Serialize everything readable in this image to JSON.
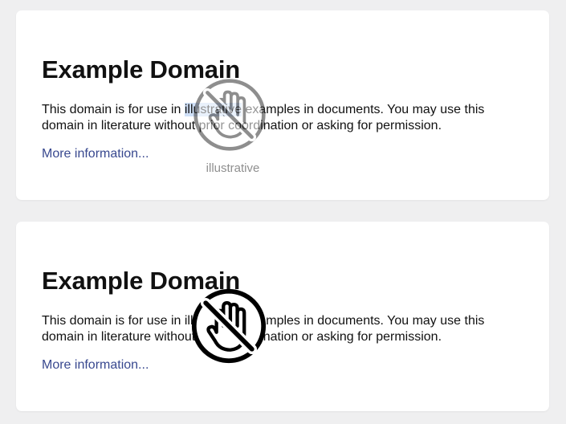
{
  "page": {
    "heading": "Example Domain",
    "paragraph_before": "This domain is for use in ",
    "paragraph_word": "illustrative",
    "paragraph_after": " examples in documents. You may use this domain in literature without prior coordination or asking for permission.",
    "link_text": "More information..."
  },
  "drag": {
    "ghost_label": "illustrative",
    "cursor_icon": "no-drop-hand-icon"
  },
  "colors": {
    "background": "#efeff0",
    "card": "#ffffff",
    "link": "#38488f",
    "selection": "#cfe0f7"
  }
}
